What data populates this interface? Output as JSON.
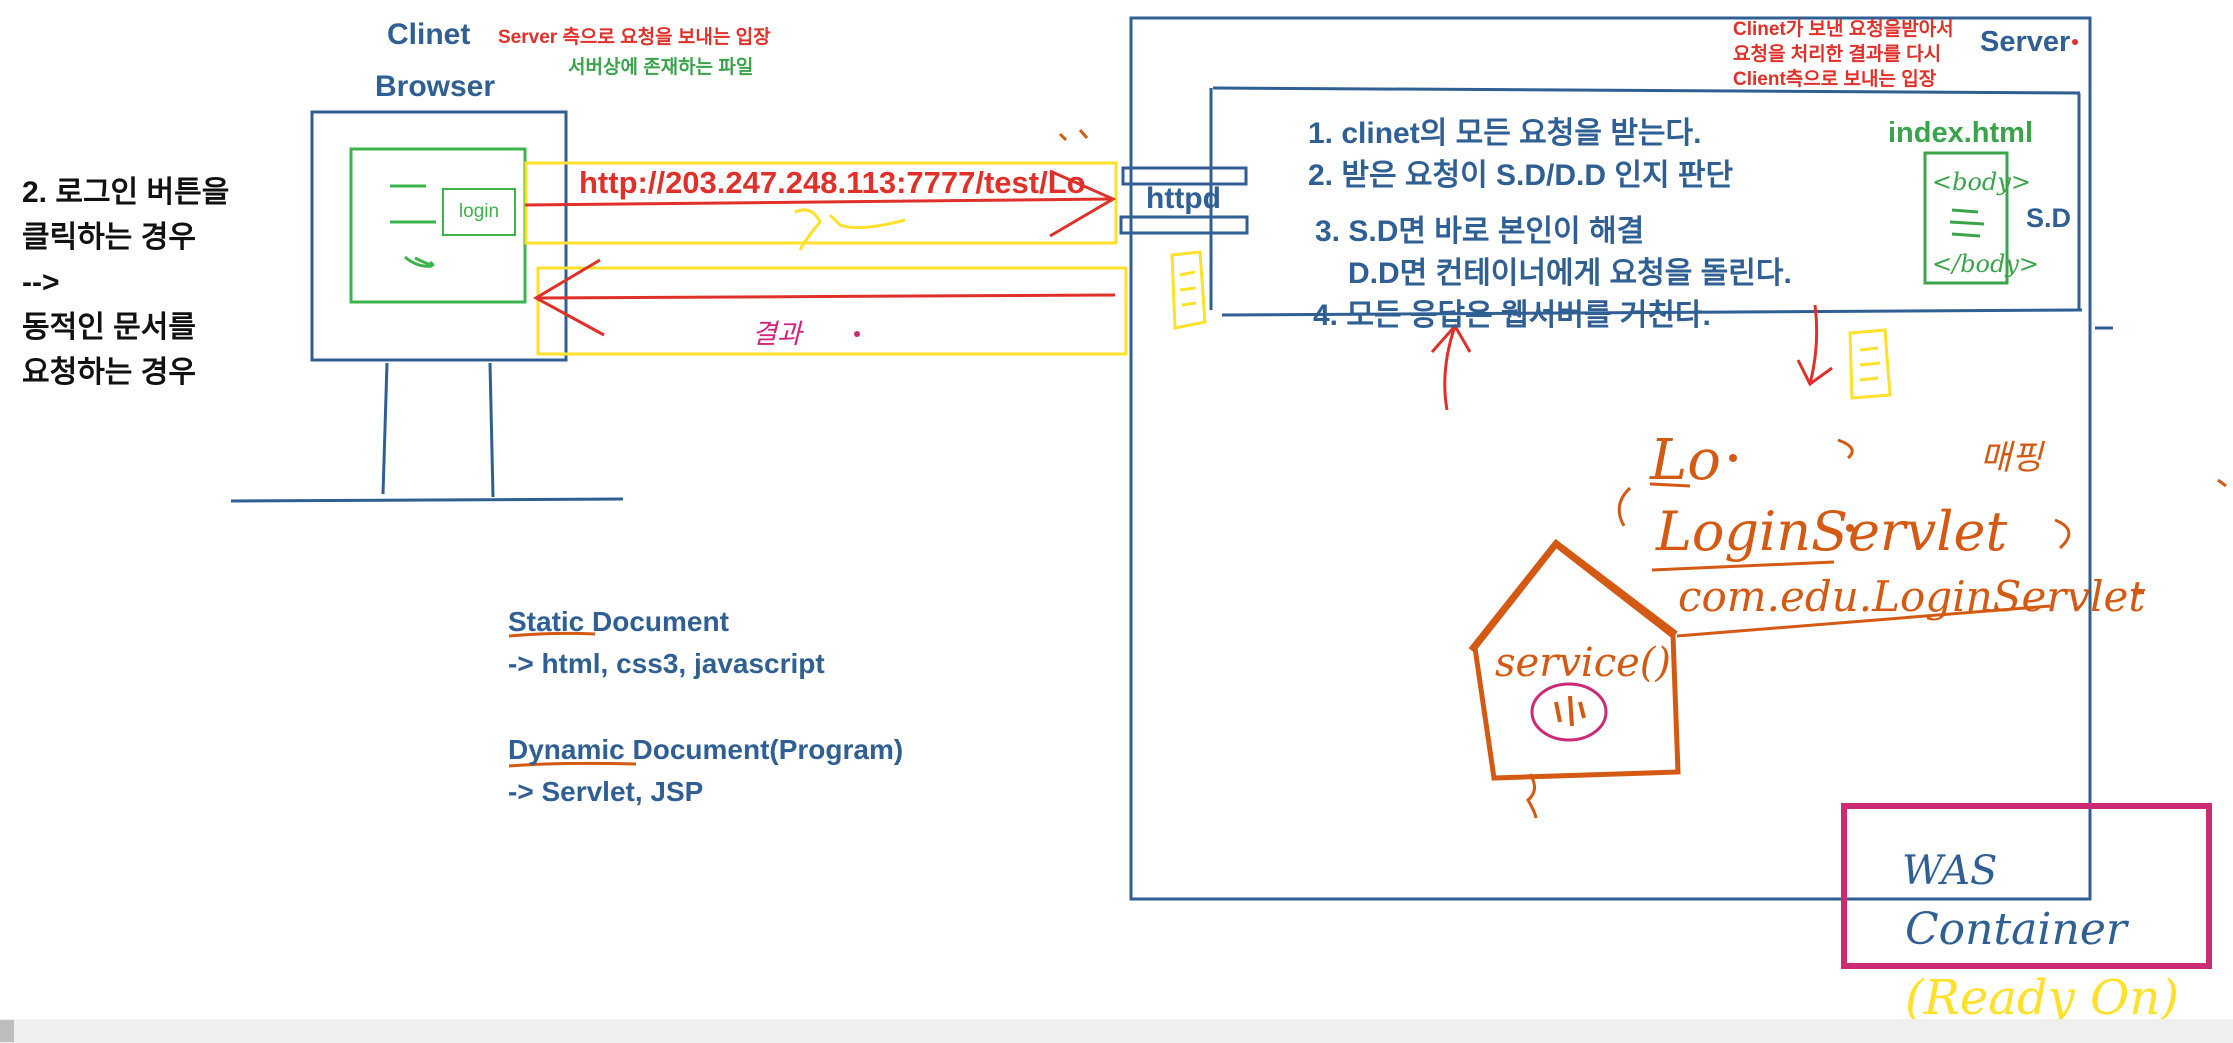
{
  "client": {
    "title": "Clinet",
    "subtitle": "Browser",
    "request_note": "Server 측으로 요청을 보내는 입장",
    "file_note": "서버상에 존재하는 파일",
    "login_button": "login"
  },
  "login_description": "2. 로그인 버튼을\n클릭하는 경우\n-->\n동적인 문서를\n요청하는 경우",
  "url": "http://203.247.248.113:7777/test/Lo",
  "server": {
    "label": "Server",
    "description": "Clinet가 보낸 요청을받아서\n요청을 처리한 결과를 다시\nClient측으로 보내는 입장",
    "httpd": "httpd",
    "steps": [
      "1. clinet의 모든 요청을 받는다.",
      "2. 받은 요청이 S.D/D.D 인지 판단",
      "3. S.D면 바로 본인이 해결",
      "D.D면 컨테이너에게 요청을 돌린다.",
      "4. 모든 응답은 웹서버를 거친다."
    ],
    "index_file": "index.html",
    "sd_label": "S.D"
  },
  "documents": {
    "static_title": "Static Document",
    "static_items": "-> html, css3, javascript",
    "dynamic_title": "Dynamic Document(Program)",
    "dynamic_items": "-> Servlet, JSP"
  },
  "handwriting": {
    "was": "WAS",
    "container": "Container",
    "ready": "(Ready On)",
    "lo": "Lo",
    "servlet_name": "LoginServlet",
    "servlet_class": "com.edu.LoginServlet",
    "service": "service()",
    "mapping": "매핑",
    "result": "결과"
  },
  "colors": {
    "blue": "#2f5f93",
    "red": "#e0302a",
    "green": "#3ba44b",
    "yellow": "#ffe02a",
    "orange": "#d45a14",
    "magenta": "#cc2b74"
  }
}
